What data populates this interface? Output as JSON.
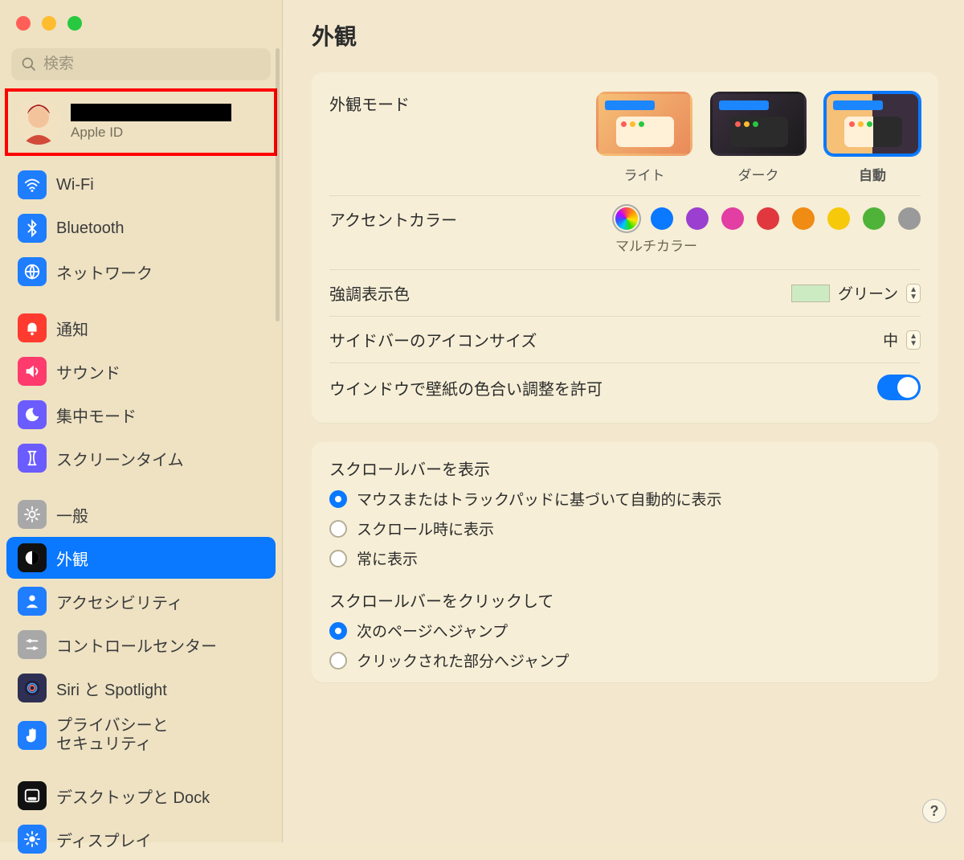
{
  "window": {
    "traffic": [
      "close",
      "minimize",
      "fullscreen"
    ]
  },
  "search": {
    "placeholder": "検索"
  },
  "appleid": {
    "name_redacted": true,
    "sub": "Apple ID"
  },
  "sidebar": {
    "groups": [
      [
        {
          "id": "wifi",
          "label": "Wi-Fi",
          "icon": "wifi",
          "bg": "#1f7dff",
          "fg": "#fff"
        },
        {
          "id": "bluetooth",
          "label": "Bluetooth",
          "icon": "bluetooth",
          "bg": "#1f7dff",
          "fg": "#fff"
        },
        {
          "id": "network",
          "label": "ネットワーク",
          "icon": "globe",
          "bg": "#1f7dff",
          "fg": "#fff"
        }
      ],
      [
        {
          "id": "notifications",
          "label": "通知",
          "icon": "bell",
          "bg": "#ff3b30",
          "fg": "#fff"
        },
        {
          "id": "sound",
          "label": "サウンド",
          "icon": "speaker",
          "bg": "#ff3b6e",
          "fg": "#fff"
        },
        {
          "id": "focus",
          "label": "集中モード",
          "icon": "moon",
          "bg": "#6b5cff",
          "fg": "#fff"
        },
        {
          "id": "screentime",
          "label": "スクリーンタイム",
          "icon": "hourglass",
          "bg": "#6b5cff",
          "fg": "#fff"
        }
      ],
      [
        {
          "id": "general",
          "label": "一般",
          "icon": "gear",
          "bg": "#a8a8a8",
          "fg": "#fff"
        },
        {
          "id": "appearance",
          "label": "外観",
          "icon": "contrast",
          "bg": "#111",
          "fg": "#fff",
          "active": true
        },
        {
          "id": "accessibility",
          "label": "アクセシビリティ",
          "icon": "person",
          "bg": "#1f7dff",
          "fg": "#fff"
        },
        {
          "id": "controlcenter",
          "label": "コントロールセンター",
          "icon": "sliders",
          "bg": "#a8a8a8",
          "fg": "#fff"
        },
        {
          "id": "siri",
          "label": "Siri と Spotlight",
          "icon": "siri",
          "bg": "#2f2f53",
          "fg": "#fff"
        },
        {
          "id": "privacy",
          "label": "プライバシーとセキュリティ",
          "icon": "hand",
          "bg": "#1f7dff",
          "fg": "#fff",
          "two_line": true,
          "label_lines": [
            "プライバシーと",
            "セキュリティ"
          ]
        }
      ],
      [
        {
          "id": "desktop",
          "label": "デスクトップと Dock",
          "icon": "dock",
          "bg": "#111",
          "fg": "#fff"
        },
        {
          "id": "display",
          "label": "ディスプレイ",
          "icon": "sun",
          "bg": "#1f7dff",
          "fg": "#fff"
        }
      ]
    ]
  },
  "page": {
    "title": "外観",
    "appearance_mode": {
      "label": "外観モード",
      "options": [
        {
          "id": "light",
          "label": "ライト"
        },
        {
          "id": "dark",
          "label": "ダーク"
        },
        {
          "id": "auto",
          "label": "自動",
          "selected": true
        }
      ]
    },
    "accent": {
      "label": "アクセントカラー",
      "selected": "multicolor",
      "selected_label": "マルチカラー",
      "options": [
        {
          "id": "multicolor",
          "label": "マルチカラー"
        },
        {
          "id": "blue",
          "hex": "#0a78ff"
        },
        {
          "id": "purple",
          "hex": "#9a3fcf"
        },
        {
          "id": "pink",
          "hex": "#e23ea3"
        },
        {
          "id": "red",
          "hex": "#e0383e"
        },
        {
          "id": "orange",
          "hex": "#f08b14"
        },
        {
          "id": "yellow",
          "hex": "#f7c90b"
        },
        {
          "id": "green",
          "hex": "#4fb33a"
        },
        {
          "id": "gray",
          "hex": "#9a9a9a"
        }
      ]
    },
    "highlight": {
      "label": "強調表示色",
      "value": "グリーン",
      "chip": "#cdebc3"
    },
    "sidebar_icon_size": {
      "label": "サイドバーのアイコンサイズ",
      "value": "中"
    },
    "tint": {
      "label": "ウインドウで壁紙の色合い調整を許可",
      "on": true
    },
    "scrollbar_show": {
      "title": "スクロールバーを表示",
      "options": [
        {
          "id": "auto",
          "label": "マウスまたはトラックパッドに基づいて自動的に表示",
          "checked": true
        },
        {
          "id": "scrolling",
          "label": "スクロール時に表示"
        },
        {
          "id": "always",
          "label": "常に表示"
        }
      ]
    },
    "scrollbar_click": {
      "title": "スクロールバーをクリックして",
      "options": [
        {
          "id": "nextpage",
          "label": "次のページへジャンプ",
          "checked": true
        },
        {
          "id": "clicked",
          "label": "クリックされた部分へジャンプ"
        }
      ]
    },
    "help": "?"
  }
}
